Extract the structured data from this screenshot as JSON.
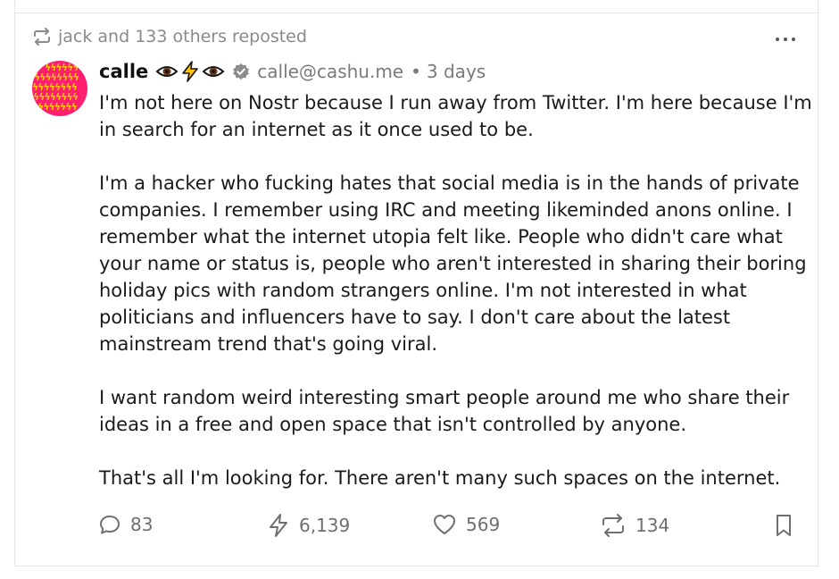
{
  "repost": {
    "text": "jack and 133 others reposted"
  },
  "note": {
    "author_name": "calle",
    "name_emojis": [
      "eye-icon",
      "lightning-icon",
      "eye-icon"
    ],
    "nip05": "calle@cashu.me",
    "separator": "•",
    "time": "3 days",
    "paragraphs": [
      "I'm not here on Nostr because I run away from Twitter. I'm here because I'm in search for an internet as it once used to be.",
      "I'm a hacker who fucking hates that social media is in the hands of private companies. I remember using IRC and meeting likeminded anons online. I remember what the internet utopia felt like. People who didn't care what your name or status is, people who aren't interested in sharing their boring holiday pics with random strangers online. I'm not interested in what politicians and influencers have to say. I don't care about the latest mainstream trend that's going viral.",
      "I want random weird interesting smart people around me who share their ideas in a free and open space that isn't controlled by anyone.",
      "That's all I'm looking for. There aren't many such spaces on the internet."
    ]
  },
  "actions": {
    "replies": "83",
    "zaps": "6,139",
    "likes": "569",
    "reposts": "134"
  },
  "colors": {
    "avatar_bg": "#ff1f6e",
    "avatar_pattern": "#ffc800",
    "muted_text": "#7a7a7a"
  }
}
